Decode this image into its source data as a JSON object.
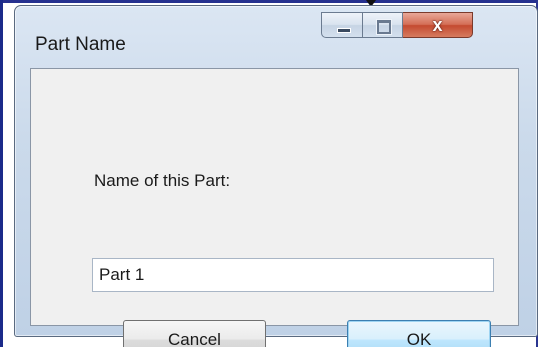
{
  "window": {
    "title": "Part Name",
    "close_glyph": "x"
  },
  "form": {
    "name_label": "Name of this Part:",
    "name_value": "Part 1"
  },
  "buttons": {
    "cancel_label": "Cancel",
    "ok_label": "OK"
  },
  "icons": {
    "minimize": "minimize-icon",
    "maximize": "maximize-icon",
    "close": "close-icon"
  },
  "colors": {
    "default_button_border": "#3c7fb1",
    "close_button": "#c44a30",
    "frame": "#cbdaeb"
  }
}
